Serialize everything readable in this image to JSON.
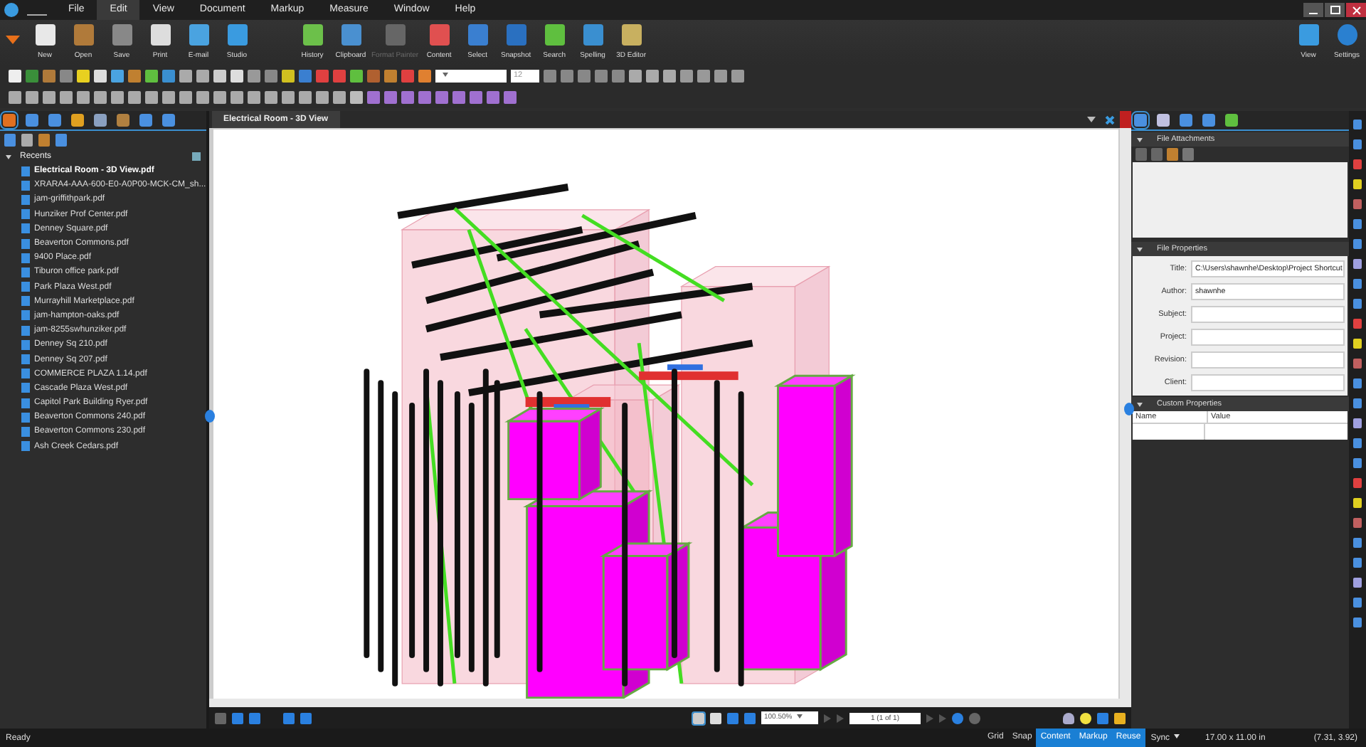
{
  "menu": [
    {
      "label": "File",
      "selected": false
    },
    {
      "label": "Edit",
      "selected": true
    },
    {
      "label": "View",
      "selected": false
    },
    {
      "label": "Document",
      "selected": false
    },
    {
      "label": "Markup",
      "selected": false
    },
    {
      "label": "Measure",
      "selected": false
    },
    {
      "label": "Window",
      "selected": false
    },
    {
      "label": "Help",
      "selected": false
    }
  ],
  "ribbon": [
    {
      "label": "New",
      "disabled": false
    },
    {
      "label": "Open",
      "disabled": false
    },
    {
      "label": "Save",
      "disabled": false
    },
    {
      "label": "Print",
      "disabled": false
    },
    {
      "label": "E-mail",
      "disabled": false
    },
    {
      "label": "Studio",
      "disabled": false
    },
    {
      "label": "History",
      "disabled": false
    },
    {
      "label": "Clipboard",
      "disabled": false
    },
    {
      "label": "Format Painter",
      "disabled": true
    },
    {
      "label": "Content",
      "disabled": false
    },
    {
      "label": "Select",
      "disabled": false
    },
    {
      "label": "Snapshot",
      "disabled": false
    },
    {
      "label": "Search",
      "disabled": false
    },
    {
      "label": "Spelling",
      "disabled": false
    },
    {
      "label": "3D Editor",
      "disabled": false
    }
  ],
  "ribbon_right": [
    {
      "label": "View"
    },
    {
      "label": "Settings"
    }
  ],
  "toolbar": {
    "font_size": "12"
  },
  "left_panel": {
    "tree": {
      "label": "Recents",
      "expanded": true,
      "children": [
        {
          "label": "Electrical Room - 3D View.pdf",
          "selected": true
        },
        {
          "label": "XRARA4-AAA-600-E0-A0P00-MCK-CM_sh...",
          "selected": false
        },
        {
          "label": "jam-griffithpark.pdf",
          "selected": false
        },
        {
          "label": "Hunziker Prof Center.pdf",
          "selected": false
        },
        {
          "label": "Denney Square.pdf",
          "selected": false
        },
        {
          "label": "Beaverton Commons.pdf",
          "selected": false
        },
        {
          "label": "9400 Place.pdf",
          "selected": false
        },
        {
          "label": "Tiburon office park.pdf",
          "selected": false
        },
        {
          "label": "Park Plaza West.pdf",
          "selected": false
        },
        {
          "label": "Murrayhill Marketplace.pdf",
          "selected": false
        },
        {
          "label": "jam-hampton-oaks.pdf",
          "selected": false
        },
        {
          "label": "jam-8255swhunziker.pdf",
          "selected": false
        },
        {
          "label": "Denney Sq 210.pdf",
          "selected": false
        },
        {
          "label": "Denney Sq 207.pdf",
          "selected": false
        },
        {
          "label": "COMMERCE PLAZA 1.14.pdf",
          "selected": false
        },
        {
          "label": "Cascade Plaza West.pdf",
          "selected": false
        },
        {
          "label": "Capitol Park Building Ryer.pdf",
          "selected": false
        },
        {
          "label": "Beaverton Commons 240.pdf",
          "selected": false
        },
        {
          "label": "Beaverton Commons 230.pdf",
          "selected": false
        },
        {
          "label": "Ash Creek Cedars.pdf",
          "selected": false
        }
      ]
    }
  },
  "document_tab": {
    "title": "Electrical Room - 3D View"
  },
  "navigation": {
    "zoom": "100.50%",
    "page": "1 (1 of 1)"
  },
  "right_panel": {
    "attachments": {
      "title": "File Attachments",
      "expanded": true
    },
    "properties": {
      "title": "File Properties",
      "expanded": true,
      "fields": [
        {
          "label": "Title:",
          "value": "C:\\Users\\shawnhe\\Desktop\\Project Shortcut"
        },
        {
          "label": "Author:",
          "value": "shawnhe"
        },
        {
          "label": "Subject:"
        },
        {
          "label": "Project:"
        },
        {
          "label": "Revision:"
        },
        {
          "label": "Client:"
        }
      ]
    },
    "custom": {
      "title": "Custom Properties",
      "expanded": true,
      "columns": [
        "Name",
        "Value"
      ]
    }
  },
  "status_bar": {
    "text": "Ready",
    "toggles": [
      {
        "label": "Grid",
        "on": false
      },
      {
        "label": "Snap",
        "on": false
      },
      {
        "label": "Content",
        "on": true
      },
      {
        "label": "Markup",
        "on": true
      },
      {
        "label": "Reuse",
        "on": true
      }
    ],
    "sync": "Sync",
    "size": "17.00 x 11.00 in",
    "coords": "(7.31, 3.92)"
  }
}
